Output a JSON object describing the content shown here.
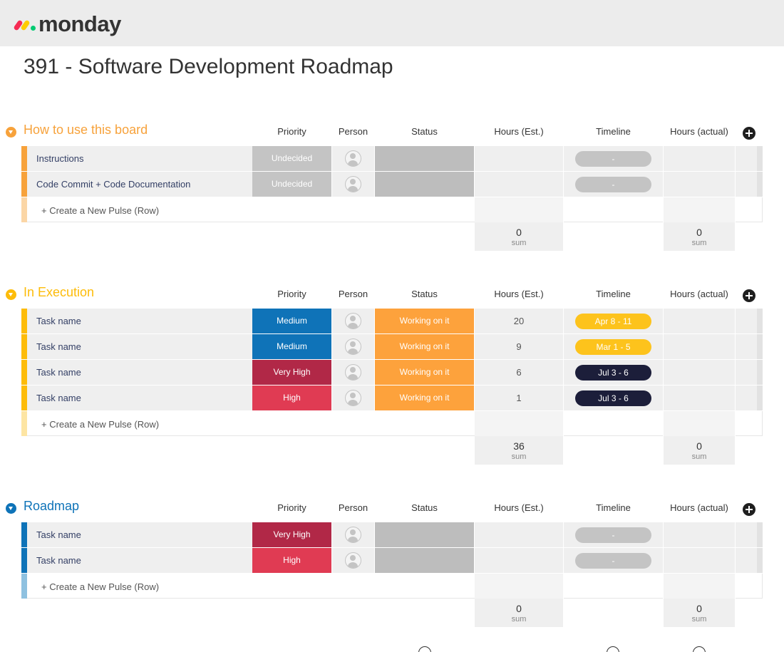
{
  "app": {
    "logo_text": "monday"
  },
  "board": {
    "title": "391 - Software Development Roadmap"
  },
  "columns": {
    "priority": "Priority",
    "person": "Person",
    "status": "Status",
    "hours_est": "Hours (Est.)",
    "timeline": "Timeline",
    "hours_actual": "Hours (actual)"
  },
  "create_label": "+ Create a New Pulse (Row)",
  "sum_label": "sum",
  "colors": {
    "group_orange": "#f7a23b",
    "group_yellow": "#fdbc0a",
    "group_blue": "#0e73b8",
    "undecided": "#c4c4c4",
    "medium": "#0f73b8",
    "very_high": "#b12847",
    "high": "#e03b53",
    "working_on_it": "#fda23c",
    "empty_status": "#bdbdbd",
    "pill_yellow": "#fdc31c",
    "pill_dark": "#1c1e3a",
    "pill_empty": "#c4c4c4"
  },
  "groups": [
    {
      "title": "How to use this board",
      "rows": [
        {
          "name": "Instructions",
          "priority": "Undecided",
          "status": "",
          "hours_est": "",
          "timeline": "-"
        },
        {
          "name": "Code Commit + Code Documentation",
          "priority": "Undecided",
          "status": "",
          "hours_est": "",
          "timeline": "-"
        }
      ],
      "sum_est": "0",
      "sum_actual": "0"
    },
    {
      "title": "In Execution",
      "rows": [
        {
          "name": "Task name",
          "priority": "Medium",
          "status": "Working on it",
          "hours_est": "20",
          "timeline": "Apr 8 - 11"
        },
        {
          "name": "Task name",
          "priority": "Medium",
          "status": "Working on it",
          "hours_est": "9",
          "timeline": "Mar 1 - 5"
        },
        {
          "name": "Task name",
          "priority": "Very High",
          "status": "Working on it",
          "hours_est": "6",
          "timeline": "Jul 3 - 6"
        },
        {
          "name": "Task name",
          "priority": "High",
          "status": "Working on it",
          "hours_est": "1",
          "timeline": "Jul 3 - 6"
        }
      ],
      "sum_est": "36",
      "sum_actual": "0"
    },
    {
      "title": "Roadmap",
      "rows": [
        {
          "name": "Task name",
          "priority": "Very High",
          "status": "",
          "hours_est": "",
          "timeline": "-"
        },
        {
          "name": "Task name",
          "priority": "High",
          "status": "",
          "hours_est": "",
          "timeline": "-"
        }
      ],
      "sum_est": "0",
      "sum_actual": "0"
    }
  ]
}
